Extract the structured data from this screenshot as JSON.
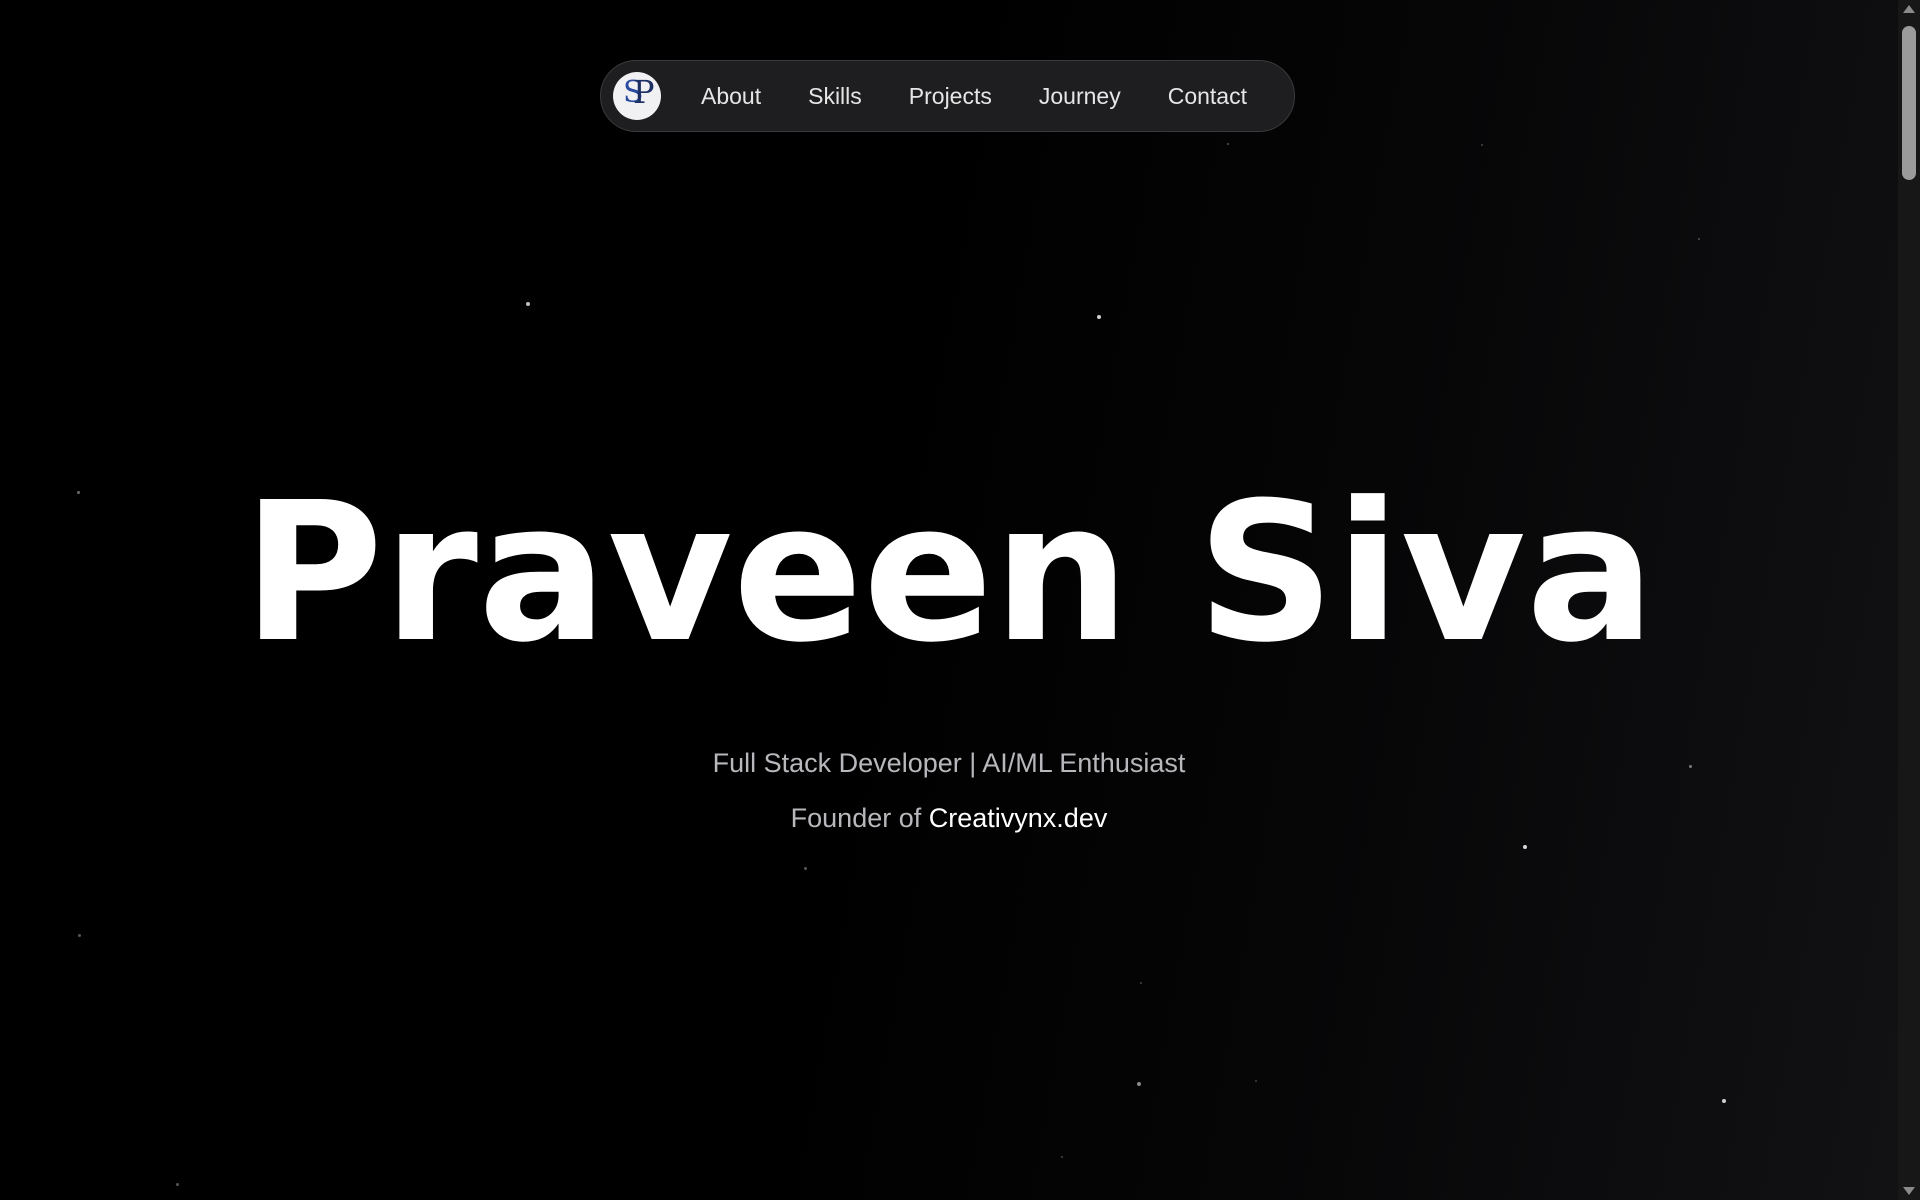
{
  "nav": {
    "logo_text": "SP",
    "links": [
      "About",
      "Skills",
      "Projects",
      "Journey",
      "Contact"
    ]
  },
  "hero": {
    "name": "Praveen Siva",
    "tagline": "Full Stack Developer | AI/ML Enthusiast",
    "founder_prefix": "Founder of",
    "founder_company": "Creativynx.dev"
  },
  "colors": {
    "background": "#000000",
    "nav_background": "#1e1e20",
    "text_primary": "#ffffff",
    "text_secondary": "#b8b8bc",
    "logo_accent": "#2a4aa0"
  }
}
